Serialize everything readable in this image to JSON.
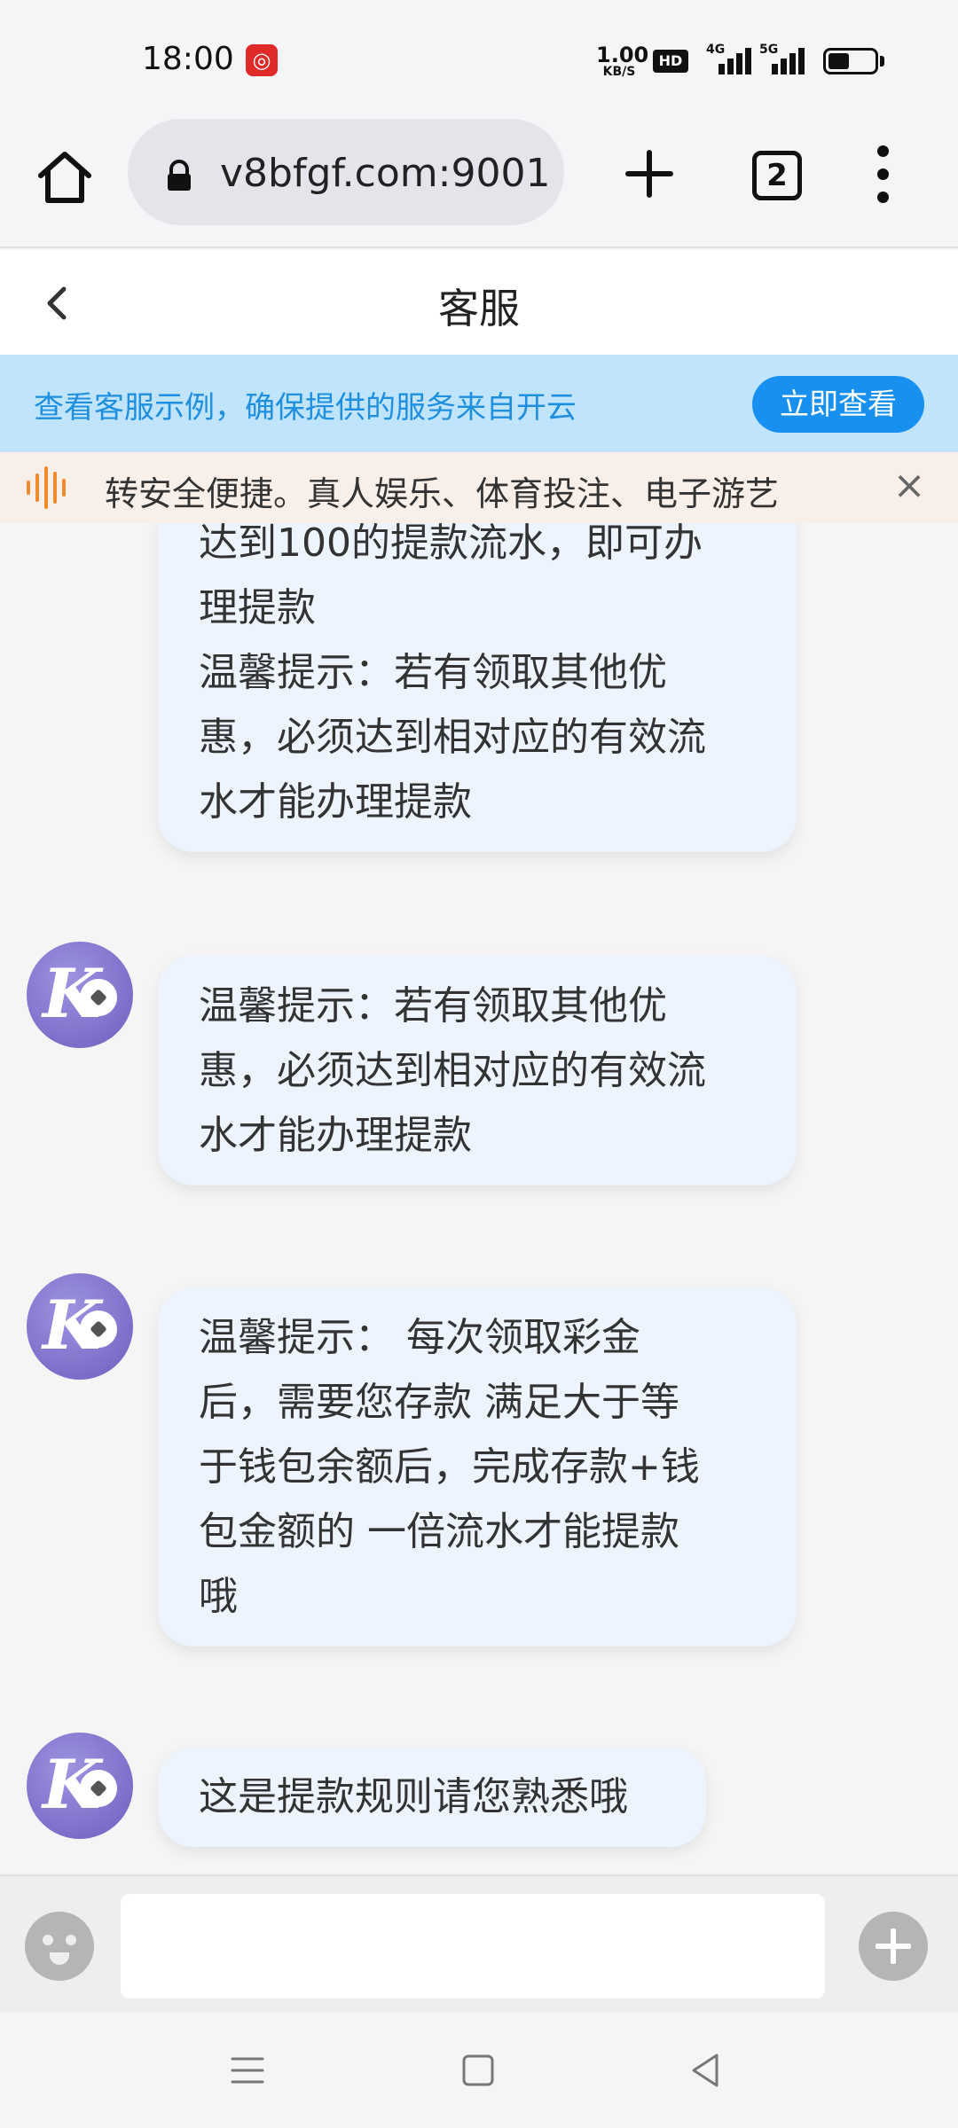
{
  "status_bar": {
    "time": "18:00",
    "net_speed_value": "1.00",
    "net_speed_unit": "KB/S",
    "hd_label": "HD",
    "sim1_label": "4G",
    "sim2_label": "5G",
    "battery_level": 0.45
  },
  "browser": {
    "url": "v8bfgf.com:9001",
    "tab_count": "2"
  },
  "header": {
    "title": "客服"
  },
  "notice": {
    "text": "查看客服示例，确保提供的服务来自开云",
    "button_label": "立即查看"
  },
  "marquee": {
    "text": "转安全便捷。真人娱乐、体育投注、电子游艺"
  },
  "messages": [
    {
      "lines": [
        "达到100的提款流水，即可办",
        "理提款",
        "温馨提示：若有领取其他优",
        "惠，必须达到相对应的有效流",
        "水才能办理提款"
      ],
      "has_avatar": false
    },
    {
      "lines": [
        "温馨提示：若有领取其他优",
        "惠，必须达到相对应的有效流",
        "水才能办理提款"
      ],
      "has_avatar": true
    },
    {
      "lines": [
        "温馨提示：  每次领取彩金",
        "后，需要您存款 满足大于等",
        "于钱包余额后，完成存款+钱",
        "包金额的 一倍流水才能提款",
        "哦"
      ],
      "has_avatar": true
    },
    {
      "lines": [
        "这是提款规则请您熟悉哦"
      ],
      "has_avatar": true
    }
  ],
  "input": {
    "value": "",
    "placeholder": ""
  },
  "icons": {
    "home": "home-icon",
    "lock": "lock-icon",
    "new_tab": "plus-icon",
    "tabs": "tabs-icon",
    "menu": "more-vert-icon",
    "back": "chevron-left-icon",
    "marquee": "sound-wave-icon",
    "close": "close-icon",
    "emoji": "emoji-icon",
    "attach": "plus-circle-icon",
    "nav_menu": "menu-icon",
    "nav_home": "square-icon",
    "nav_back": "triangle-back-icon"
  },
  "colors": {
    "accent": "#1890f0",
    "notice_bg": "#bfe4fb",
    "bubble_bg": "#edf4fe",
    "avatar": "#7d6fd0"
  }
}
